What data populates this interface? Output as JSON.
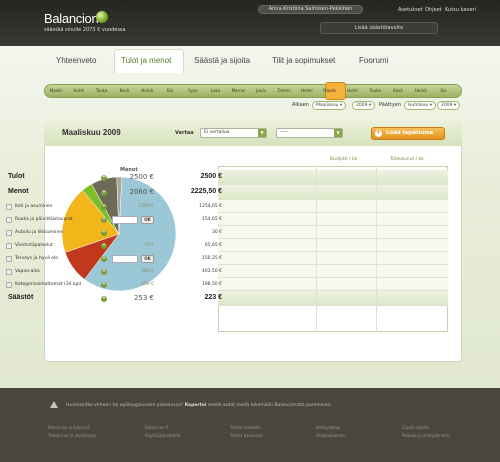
{
  "header": {
    "logo": "Balancion",
    "tagline": "säästää sinulle 2073 € vuodessa",
    "user": "Anna-Kristiina Salmisen-Pekkinen",
    "top_links": [
      "Asetukset",
      "Ohjeet",
      "Kutsu kaveri"
    ],
    "add_account": "Lisää säästötavoite"
  },
  "tabs": [
    "Yhteenveto",
    "Tulot ja menot",
    "Säästä ja sijoita",
    "Tilit ja sopimukset",
    "Foorumi"
  ],
  "months": [
    "Maalis",
    "Huhti",
    "Touko",
    "Kesä",
    "Heinä",
    "Elo",
    "Syys",
    "Loka",
    "Marras",
    "Joulu",
    "Tammi",
    "Helmi",
    "Maalis",
    "Huhti",
    "Touko",
    "Kesä",
    "Heinä",
    "Elo"
  ],
  "range": {
    "start_label": "Alkaen",
    "start_month": "Maaliskuu",
    "start_year": "2009",
    "end_label": "Päättyen",
    "end_month": "Huhtikuu",
    "end_year": "2009"
  },
  "panel": {
    "title": "Maaliskuu 2009",
    "compare_label": "Vertaa",
    "compare_value": "Ei vertailua",
    "compare2_value": "-----",
    "add_event": "Lisää tapahtuma"
  },
  "table_headers": {
    "budget": "Budjetti / kk",
    "actual": "Toteutunut / kk"
  },
  "rows": [
    {
      "type": "big",
      "label": "Tulot",
      "budget": "2500 €",
      "actual": "2500 €"
    },
    {
      "type": "big",
      "label": "Menot",
      "budget": "2060 €",
      "actual": "2225,50 €"
    },
    {
      "type": "cat",
      "label": "Koti ja asuminen",
      "budget": "1390 €",
      "actual": "1254,65 €"
    },
    {
      "type": "cat-edit",
      "label": "Ruoka ja päivittäistavarat",
      "ok": "OK",
      "actual": "154,65 €"
    },
    {
      "type": "cat",
      "label": "Autoilu ja liikkuminen",
      "budget": "",
      "actual": "30 €"
    },
    {
      "type": "cat",
      "label": "Viestintäpalvelut",
      "budget": "70 €",
      "actual": "65,65 €"
    },
    {
      "type": "cat-edit",
      "label": "Terveys ja hyvä olo",
      "ok": "OK",
      "actual": "150,25 €"
    },
    {
      "type": "cat",
      "label": "Vapaa-aika",
      "budget": "400 €",
      "actual": "403,50 €"
    },
    {
      "type": "cat",
      "label": "Kategorisoimattomat (34 kpl)",
      "budget": "200 €",
      "actual": "198,50 €"
    },
    {
      "type": "big",
      "label": "Säästöt",
      "budget": "253 €",
      "actual": "223 €"
    }
  ],
  "chart_data": {
    "type": "pie",
    "title": "Menot",
    "categories": [
      "Koti ja asuminen",
      "Kategorisoimattomat",
      "Vapaa-aika",
      "Viestintäpalvelut",
      "Ruoka ja päivittäistavarat",
      "Autoilu ja liikkuminen"
    ],
    "values": [
      1254.65,
      198.5,
      403.5,
      65.65,
      154.65,
      30
    ],
    "colors": [
      "#9cc7d6",
      "#c0391f",
      "#f2b51a",
      "#7cbf2a",
      "#6e6a58",
      "#a9a796"
    ]
  },
  "footer": {
    "notice_prefix": "Huomasitko virheen tai epäloogisuuden palvelussa?",
    "notice_link": "Raportoi",
    "notice_suffix": "meille autat meitä tekemään Balancionista paremman.",
    "links": [
      "Balancion yrityksenä",
      "Tietoturva ja yksityisyys",
      "Balancion.fi",
      "Käyttöjärjestelmä",
      "Tietoa medialle",
      "Tietoa pankeista",
      "Kehitysblogi",
      "Asiakaspalvelu",
      "Löydä ohjeita",
      "Palaute ja yhteydenotto"
    ]
  }
}
